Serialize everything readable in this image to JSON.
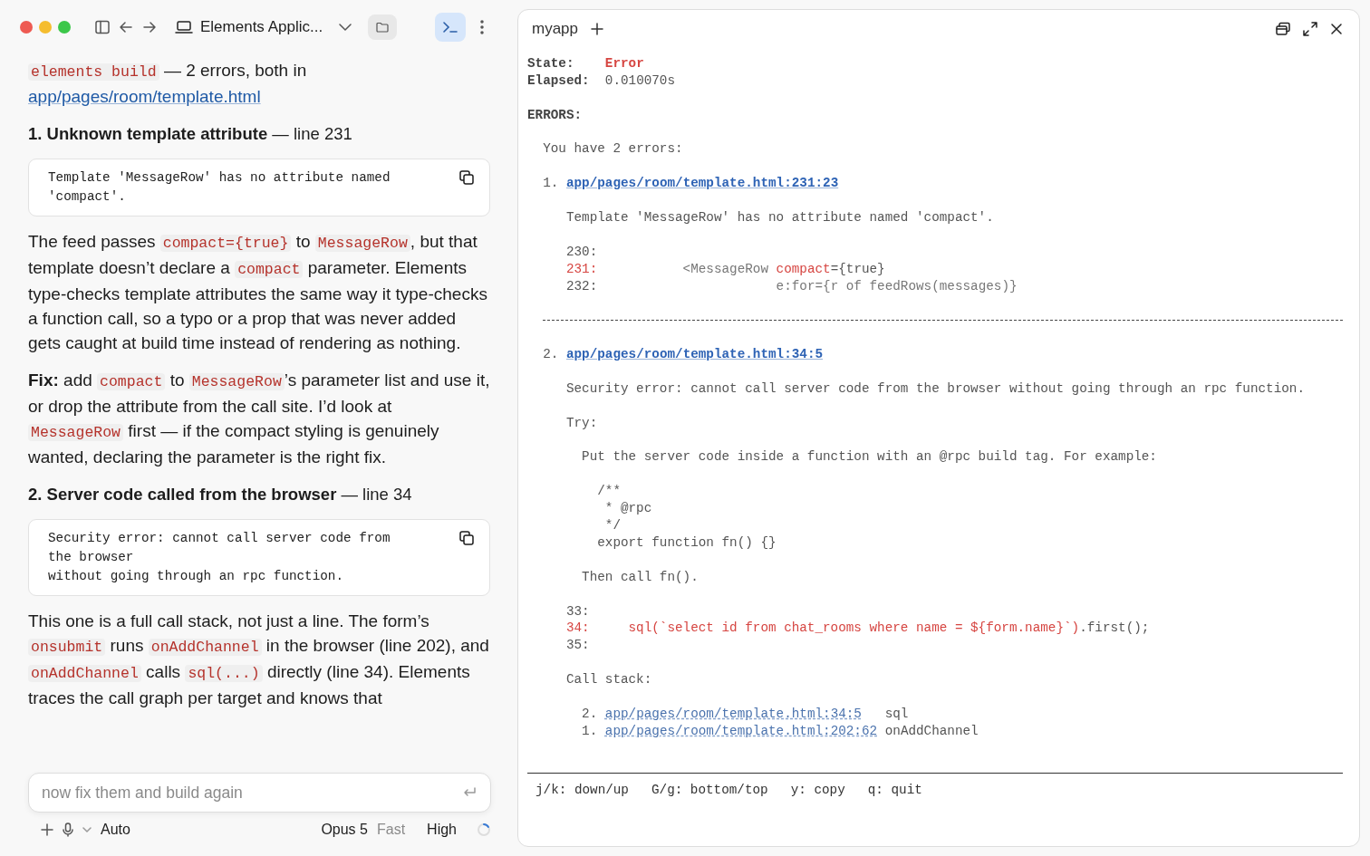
{
  "toolbar": {
    "title": "Elements Applic...",
    "folder_selected": false,
    "terminal_selected": true
  },
  "chat": [
    {
      "kind": "paragraph",
      "segments": [
        {
          "kind": "code",
          "text": "elements build"
        },
        {
          "kind": "text",
          "text": " — 2 errors, both in "
        },
        {
          "kind": "link",
          "text": "app/pages/room/template.html"
        }
      ]
    },
    {
      "kind": "heading",
      "text": "**1. Unknown template attribute** — line 231"
    },
    {
      "kind": "codeblock",
      "text": "Template 'MessageRow' has no attribute named\n'compact'."
    },
    {
      "kind": "paragraph",
      "segments": [
        {
          "kind": "text",
          "text": "The feed passes "
        },
        {
          "kind": "code",
          "text": "compact={true}"
        },
        {
          "kind": "text",
          "text": " to "
        },
        {
          "kind": "code",
          "text": "MessageRow"
        },
        {
          "kind": "text",
          "text": ", but that template doesn’t declare a "
        },
        {
          "kind": "code",
          "text": "compact"
        },
        {
          "kind": "text",
          "text": " parameter. Elements type-checks template attributes the same way it type-checks a function call, so a typo or a prop that was never added gets caught at build time instead of rendering as nothing."
        }
      ]
    },
    {
      "kind": "paragraph",
      "segments": [
        {
          "kind": "text",
          "text": "**Fix:** add "
        },
        {
          "kind": "code",
          "text": "compact"
        },
        {
          "kind": "text",
          "text": " to "
        },
        {
          "kind": "code",
          "text": "MessageRow"
        },
        {
          "kind": "text",
          "text": "’s parameter list and use it, or drop the attribute from the call site. I’d look at "
        },
        {
          "kind": "code",
          "text": "MessageRow"
        },
        {
          "kind": "text",
          "text": " first — if the compact styling is genuinely wanted, declaring the parameter is the right fix."
        }
      ]
    },
    {
      "kind": "heading",
      "text": "**2. Server code called from the browser** — line 34"
    },
    {
      "kind": "codeblock",
      "text": "Security error: cannot call server code from\nthe browser\nwithout going through an rpc function."
    },
    {
      "kind": "paragraph",
      "segments": [
        {
          "kind": "text",
          "text": "This one is a full call stack, not just a line. The form’s "
        },
        {
          "kind": "code",
          "text": "onsubmit"
        },
        {
          "kind": "text",
          "text": " runs "
        },
        {
          "kind": "code",
          "text": "onAddChannel"
        },
        {
          "kind": "text",
          "text": " in the browser (line 202), and "
        },
        {
          "kind": "code",
          "text": "onAddChannel"
        },
        {
          "kind": "text",
          "text": " calls "
        },
        {
          "kind": "code",
          "text": "sql(...)"
        },
        {
          "kind": "text",
          "text": " directly (line 34). Elements traces the call graph per target and knows that"
        }
      ]
    }
  ],
  "composer": {
    "placeholder": "now fix them and build again",
    "mode": "Auto",
    "model": "Opus 5",
    "speed": "Fast",
    "effort": "High"
  },
  "terminal": {
    "tab": "myapp",
    "lines": [
      {
        "kind": "line",
        "segments": [
          {
            "kind": "label",
            "text": "State:    "
          },
          {
            "kind": "status",
            "text": "Error"
          }
        ]
      },
      {
        "kind": "line",
        "segments": [
          {
            "kind": "label",
            "text": "Elapsed:  "
          },
          {
            "kind": "plain",
            "text": "0.010070s"
          }
        ]
      },
      {
        "kind": "blank"
      },
      {
        "kind": "line",
        "segments": [
          {
            "kind": "label",
            "text": "ERRORS:"
          }
        ]
      },
      {
        "kind": "blank"
      },
      {
        "kind": "line",
        "segments": [
          {
            "kind": "plain",
            "text": "  You have 2 errors:"
          }
        ]
      },
      {
        "kind": "blank"
      },
      {
        "kind": "line",
        "segments": [
          {
            "kind": "plain",
            "text": "  1. "
          },
          {
            "kind": "link",
            "text": "app/pages/room/template.html:231:23"
          }
        ]
      },
      {
        "kind": "blank"
      },
      {
        "kind": "line",
        "segments": [
          {
            "kind": "plain",
            "text": "     Template 'MessageRow' has no attribute named 'compact'."
          }
        ]
      },
      {
        "kind": "blank"
      },
      {
        "kind": "line",
        "segments": [
          {
            "kind": "plain",
            "text": "     230:"
          }
        ]
      },
      {
        "kind": "line",
        "segments": [
          {
            "kind": "error",
            "text": "     231:"
          },
          {
            "kind": "muted",
            "text": "           <MessageRow "
          },
          {
            "kind": "error",
            "text": "compact"
          },
          {
            "kind": "plain",
            "text": "={true}"
          }
        ]
      },
      {
        "kind": "line",
        "segments": [
          {
            "kind": "plain",
            "text": "     232:"
          },
          {
            "kind": "muted",
            "text": "                       e:for={r of feedRows(messages)}"
          }
        ]
      },
      {
        "kind": "blank"
      },
      {
        "kind": "divider"
      },
      {
        "kind": "blank"
      },
      {
        "kind": "line",
        "segments": [
          {
            "kind": "plain",
            "text": "  2. "
          },
          {
            "kind": "link",
            "text": "app/pages/room/template.html:34:5"
          }
        ]
      },
      {
        "kind": "blank"
      },
      {
        "kind": "line",
        "segments": [
          {
            "kind": "plain",
            "text": "     Security error: cannot call server code from the browser without going through an rpc function."
          }
        ]
      },
      {
        "kind": "blank"
      },
      {
        "kind": "line",
        "segments": [
          {
            "kind": "plain",
            "text": "     Try:"
          }
        ]
      },
      {
        "kind": "blank"
      },
      {
        "kind": "line",
        "segments": [
          {
            "kind": "plain",
            "text": "       Put the server code inside a function with an @rpc build tag. For example:"
          }
        ]
      },
      {
        "kind": "blank"
      },
      {
        "kind": "line",
        "segments": [
          {
            "kind": "plain",
            "text": "         /**"
          }
        ]
      },
      {
        "kind": "line",
        "segments": [
          {
            "kind": "plain",
            "text": "          * @rpc"
          }
        ]
      },
      {
        "kind": "line",
        "segments": [
          {
            "kind": "plain",
            "text": "          */"
          }
        ]
      },
      {
        "kind": "line",
        "segments": [
          {
            "kind": "plain",
            "text": "         export function fn() {}"
          }
        ]
      },
      {
        "kind": "blank"
      },
      {
        "kind": "line",
        "segments": [
          {
            "kind": "plain",
            "text": "       Then call fn()."
          }
        ]
      },
      {
        "kind": "blank"
      },
      {
        "kind": "line",
        "segments": [
          {
            "kind": "plain",
            "text": "     33:"
          }
        ]
      },
      {
        "kind": "line",
        "segments": [
          {
            "kind": "error",
            "text": "     34:     sql(`select id from chat_rooms where name = ${form.name}`)"
          },
          {
            "kind": "plain",
            "text": ".first();"
          }
        ]
      },
      {
        "kind": "line",
        "segments": [
          {
            "kind": "plain",
            "text": "     35:"
          }
        ]
      },
      {
        "kind": "blank"
      },
      {
        "kind": "line",
        "segments": [
          {
            "kind": "plain",
            "text": "     Call stack:"
          }
        ]
      },
      {
        "kind": "blank"
      },
      {
        "kind": "line",
        "segments": [
          {
            "kind": "plain",
            "text": "       2. "
          },
          {
            "kind": "stack-link",
            "text": "app/pages/room/template.html:34:5"
          },
          {
            "kind": "plain",
            "text": "   sql"
          }
        ]
      },
      {
        "kind": "line",
        "segments": [
          {
            "kind": "plain",
            "text": "       1. "
          },
          {
            "kind": "stack-link",
            "text": "app/pages/room/template.html:202:62"
          },
          {
            "kind": "plain",
            "text": " onAddChannel"
          }
        ]
      }
    ],
    "keys": [
      "j/k: down/up",
      "G/g: bottom/top",
      "y: copy",
      "q: quit"
    ]
  }
}
